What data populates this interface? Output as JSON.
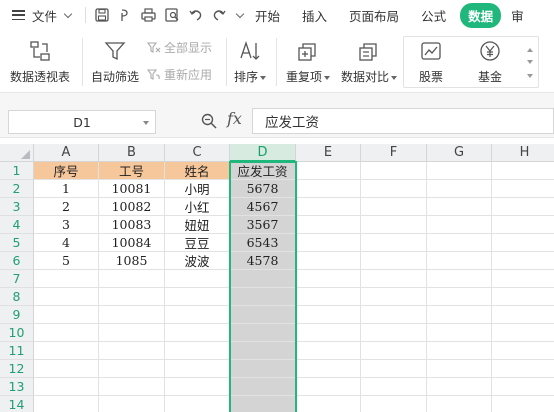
{
  "menu": {
    "file_label": "文件",
    "tabs": [
      "开始",
      "插入",
      "页面布局",
      "公式",
      "数据"
    ],
    "active_tab": "数据",
    "overflow_char": "审"
  },
  "ribbon": {
    "pivot": "数据透视表",
    "autofilter": "自动筛选",
    "show_all": "全部显示",
    "reapply": "重新应用",
    "sort": "排序",
    "duplicates": "重复项",
    "compare": "数据对比",
    "stocks": "股票",
    "funds": "基金"
  },
  "formula_bar": {
    "name_box": "D1",
    "fx": "fx",
    "content": "应发工资"
  },
  "sheet": {
    "columns": [
      "A",
      "B",
      "C",
      "D",
      "E",
      "F",
      "G",
      "H"
    ],
    "selected_column": "D",
    "row_numbers": [
      "1",
      "2",
      "3",
      "4",
      "5",
      "6",
      "7",
      "8",
      "9",
      "10",
      "11",
      "12",
      "13",
      "14"
    ],
    "rows": [
      [
        "序号",
        "工号",
        "姓名",
        "应发工资"
      ],
      [
        "1",
        "10081",
        "小明",
        "5678"
      ],
      [
        "2",
        "10082",
        "小红",
        "4567"
      ],
      [
        "3",
        "10083",
        "妞妞",
        "3567"
      ],
      [
        "4",
        "10084",
        "豆豆",
        "6543"
      ],
      [
        "5",
        "1085",
        "波波",
        "4578"
      ]
    ]
  },
  "colors": {
    "accent": "#20b77c",
    "header_fill": "#f7c79c",
    "selection_fill": "#d4d4d4"
  }
}
